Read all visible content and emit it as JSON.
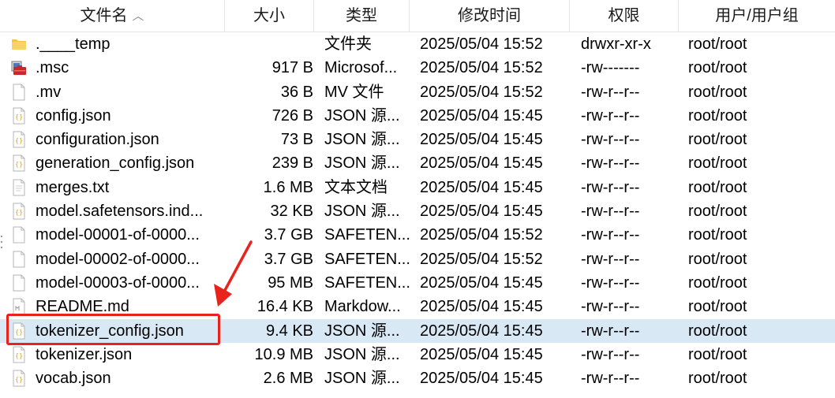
{
  "columns": {
    "name": "文件名",
    "size": "大小",
    "type": "类型",
    "modified": "修改时间",
    "perms": "权限",
    "owner": "用户/用户组"
  },
  "sort_indicator": "^",
  "files": [
    {
      "name": ".____temp",
      "size": "",
      "type": "文件夹",
      "modified": "2025/05/04 15:52",
      "perms": "drwxr-xr-x",
      "owner": "root/root",
      "icon": "folder-icon"
    },
    {
      "name": ".msc",
      "size": "917 B",
      "type": "Microsof...",
      "modified": "2025/05/04 15:52",
      "perms": "-rw-------",
      "owner": "root/root",
      "icon": "msc-file-icon"
    },
    {
      "name": ".mv",
      "size": "36 B",
      "type": "MV 文件",
      "modified": "2025/05/04 15:52",
      "perms": "-rw-r--r--",
      "owner": "root/root",
      "icon": "file-icon"
    },
    {
      "name": "config.json",
      "size": "726 B",
      "type": "JSON 源...",
      "modified": "2025/05/04 15:45",
      "perms": "-rw-r--r--",
      "owner": "root/root",
      "icon": "json-file-icon"
    },
    {
      "name": "configuration.json",
      "size": "73 B",
      "type": "JSON 源...",
      "modified": "2025/05/04 15:45",
      "perms": "-rw-r--r--",
      "owner": "root/root",
      "icon": "json-file-icon"
    },
    {
      "name": "generation_config.json",
      "size": "239 B",
      "type": "JSON 源...",
      "modified": "2025/05/04 15:45",
      "perms": "-rw-r--r--",
      "owner": "root/root",
      "icon": "json-file-icon"
    },
    {
      "name": "merges.txt",
      "size": "1.6 MB",
      "type": "文本文档",
      "modified": "2025/05/04 15:45",
      "perms": "-rw-r--r--",
      "owner": "root/root",
      "icon": "text-file-icon"
    },
    {
      "name": "model.safetensors.ind...",
      "size": "32 KB",
      "type": "JSON 源...",
      "modified": "2025/05/04 15:45",
      "perms": "-rw-r--r--",
      "owner": "root/root",
      "icon": "json-file-icon"
    },
    {
      "name": "model-00001-of-0000...",
      "size": "3.7 GB",
      "type": "SAFETEN...",
      "modified": "2025/05/04 15:52",
      "perms": "-rw-r--r--",
      "owner": "root/root",
      "icon": "file-icon"
    },
    {
      "name": "model-00002-of-0000...",
      "size": "3.7 GB",
      "type": "SAFETEN...",
      "modified": "2025/05/04 15:52",
      "perms": "-rw-r--r--",
      "owner": "root/root",
      "icon": "file-icon"
    },
    {
      "name": "model-00003-of-0000...",
      "size": "95 MB",
      "type": "SAFETEN...",
      "modified": "2025/05/04 15:45",
      "perms": "-rw-r--r--",
      "owner": "root/root",
      "icon": "file-icon"
    },
    {
      "name": "README.md",
      "size": "16.4 KB",
      "type": "Markdow...",
      "modified": "2025/05/04 15:45",
      "perms": "-rw-r--r--",
      "owner": "root/root",
      "icon": "markdown-file-icon"
    },
    {
      "name": "tokenizer_config.json",
      "size": "9.4 KB",
      "type": "JSON 源...",
      "modified": "2025/05/04 15:45",
      "perms": "-rw-r--r--",
      "owner": "root/root",
      "icon": "json-file-icon",
      "selected": true
    },
    {
      "name": "tokenizer.json",
      "size": "10.9 MB",
      "type": "JSON 源...",
      "modified": "2025/05/04 15:45",
      "perms": "-rw-r--r--",
      "owner": "root/root",
      "icon": "json-file-icon"
    },
    {
      "name": "vocab.json",
      "size": "2.6 MB",
      "type": "JSON 源...",
      "modified": "2025/05/04 15:45",
      "perms": "-rw-r--r--",
      "owner": "root/root",
      "icon": "json-file-icon"
    }
  ],
  "colors": {
    "selected_row": "#d9e8f5",
    "annotation": "#e8231c",
    "folder": "#f5c243",
    "json_icon": "#d8b84a"
  }
}
